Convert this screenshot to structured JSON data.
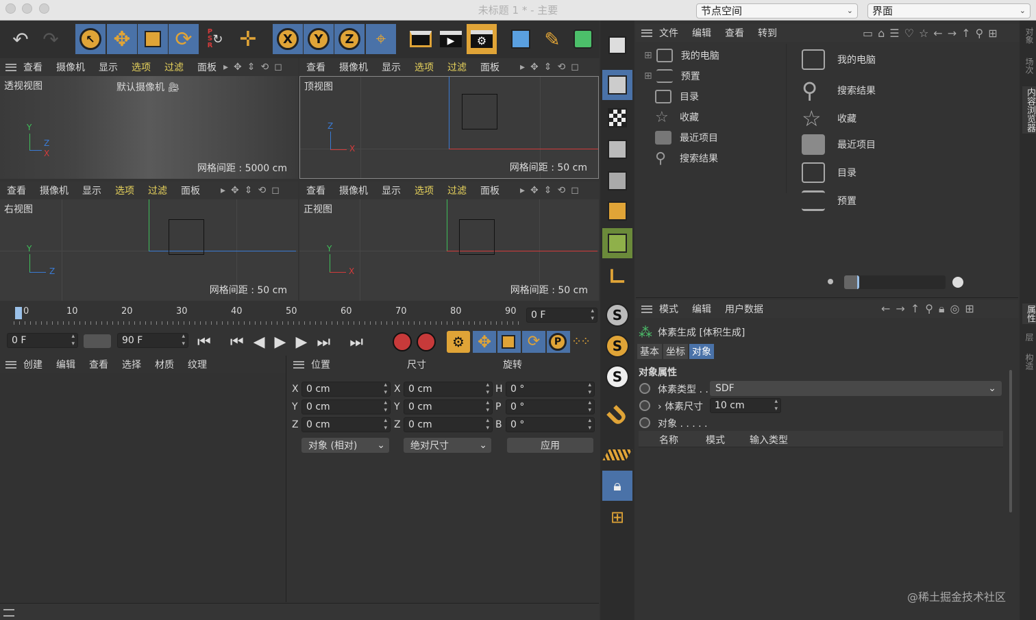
{
  "window": {
    "title": "未标题 1 * - 主要",
    "node_space_label": "节点空间",
    "layout_label": "界面"
  },
  "viewport_menu": {
    "items": [
      "查看",
      "摄像机",
      "显示",
      "选项",
      "过滤",
      "面板"
    ]
  },
  "viewports": {
    "perspective": {
      "label": "透视视图",
      "camera": "默认摄像机",
      "grid": "网格间距 : 5000 cm"
    },
    "top": {
      "label": "顶视图",
      "grid": "网格间距 : 50 cm"
    },
    "right": {
      "label": "右视图",
      "grid": "网格间距 : 50 cm"
    },
    "front": {
      "label": "正视图",
      "grid": "网格间距 : 50 cm"
    }
  },
  "axes": {
    "x": "X",
    "y": "Y",
    "z": "Z"
  },
  "coord_buttons": [
    "X",
    "Y",
    "Z"
  ],
  "timeline": {
    "ticks": [
      "0",
      "10",
      "20",
      "30",
      "40",
      "50",
      "60",
      "70",
      "80",
      "90"
    ],
    "current_frame": "0 F",
    "start": "0 F",
    "end": "90 F",
    "p_label": "P"
  },
  "materials_menu": {
    "items": [
      "创建",
      "编辑",
      "查看",
      "选择",
      "材质",
      "纹理"
    ]
  },
  "coords": {
    "headers": [
      "位置",
      "尺寸",
      "旋转"
    ],
    "rows": [
      {
        "pl": "X",
        "pv": "0 cm",
        "sl": "X",
        "sv": "0 cm",
        "rl": "H",
        "rv": "0 °"
      },
      {
        "pl": "Y",
        "pv": "0 cm",
        "sl": "Y",
        "sv": "0 cm",
        "rl": "P",
        "rv": "0 °"
      },
      {
        "pl": "Z",
        "pv": "0 cm",
        "sl": "Z",
        "sv": "0 cm",
        "rl": "B",
        "rv": "0 °"
      }
    ],
    "mode": "对象 (相对)",
    "size_mode": "绝对尺寸",
    "apply": "应用"
  },
  "browser_menu": {
    "items": [
      "文件",
      "编辑",
      "查看",
      "转到"
    ]
  },
  "browser_tree": [
    "我的电脑",
    "预置",
    "目录",
    "收藏",
    "最近项目",
    "搜索结果"
  ],
  "browser_grid": [
    "我的电脑",
    "搜索结果",
    "收藏",
    "最近项目",
    "目录",
    "预置"
  ],
  "side_tabs": [
    "对象",
    "场次",
    "内容浏览器",
    "属性",
    "层",
    "构造"
  ],
  "attributes": {
    "menu": [
      "模式",
      "编辑",
      "用户数据"
    ],
    "object_title": "体素生成 [体积生成]",
    "tabs": [
      "基本",
      "坐标",
      "对象"
    ],
    "section": "对象属性",
    "voxel_type_label": "体素类型 . .",
    "voxel_type_value": "SDF",
    "voxel_size_label": "体素尺寸",
    "voxel_size_value": "10 cm",
    "objects_label": "对象 . . . . .",
    "columns": [
      "名称",
      "模式",
      "输入类型"
    ]
  },
  "watermark": "@稀土掘金技术社区",
  "colors": {
    "accent": "#4a72a8",
    "orange": "#e0a437",
    "x_axis": "#d43b3b",
    "y_axis": "#3fbf5a",
    "z_axis": "#3a7bd5",
    "highlight_text": "#e8d35c"
  }
}
